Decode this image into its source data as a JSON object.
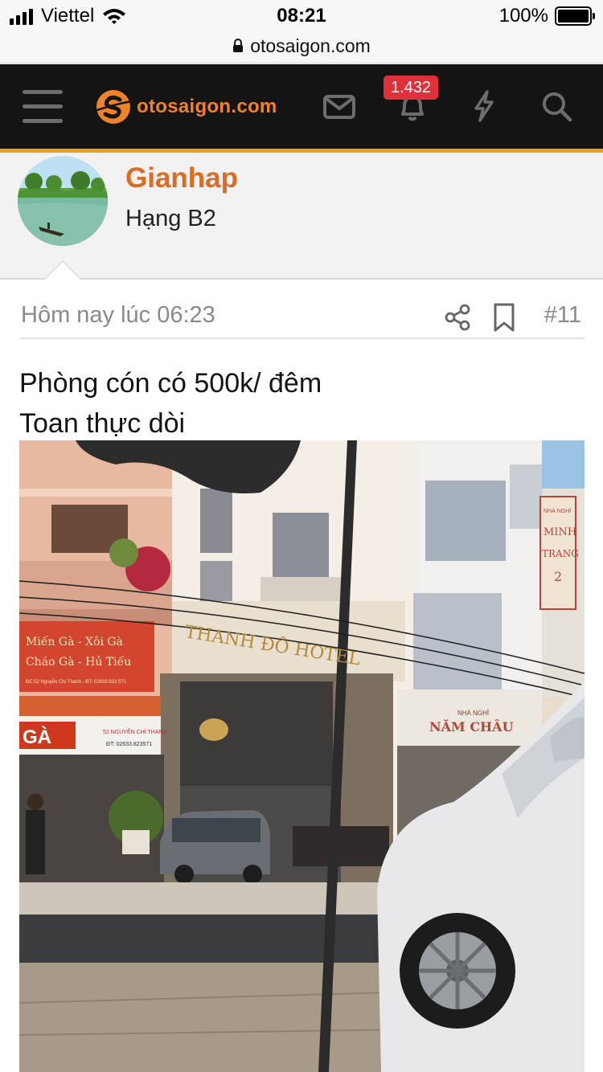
{
  "status_bar": {
    "carrier": "Viettel",
    "time": "08:21",
    "battery": "100%"
  },
  "browser": {
    "url": "otosaigon.com"
  },
  "header": {
    "logo_text": "otosaigon.com",
    "notification_count": "1.432",
    "icons": [
      "menu-icon",
      "envelope-icon",
      "bell-icon",
      "lightning-icon",
      "search-icon"
    ]
  },
  "user": {
    "name": "Gianhap",
    "rank": "Hạng B2"
  },
  "post": {
    "date": "Hôm nay lúc 06:23",
    "number": "#11",
    "lines": [
      "Phòng cón có 500k/ đêm",
      "Toan thực dòi"
    ]
  },
  "photo_signs": {
    "hotel": "THANH ĐÔ HOTEL",
    "left_top": "Miến Gà - Xôi Gà",
    "left_mid": "Cháo Gà - Hủ Tiếu",
    "left_addr": "ĐC:52 Nguyễn Chí Thanh - ĐT: 02633 823 571",
    "ga": "GÀ",
    "ga_addr": "52 NGUYỄN CHÍ THANH",
    "ga_phone": "ĐT: 02633.823571",
    "nha_nghi": "NHÀ NGHỈ",
    "nam_chau": "NĂM CHÂU",
    "minh_trang": [
      "NHÀ NGHỈ",
      "MINH",
      "TRANG",
      "2"
    ]
  },
  "colors": {
    "accent": "#e8a020",
    "brand": "#f0822a",
    "username": "#dc6b24",
    "badge": "#e0313a"
  }
}
